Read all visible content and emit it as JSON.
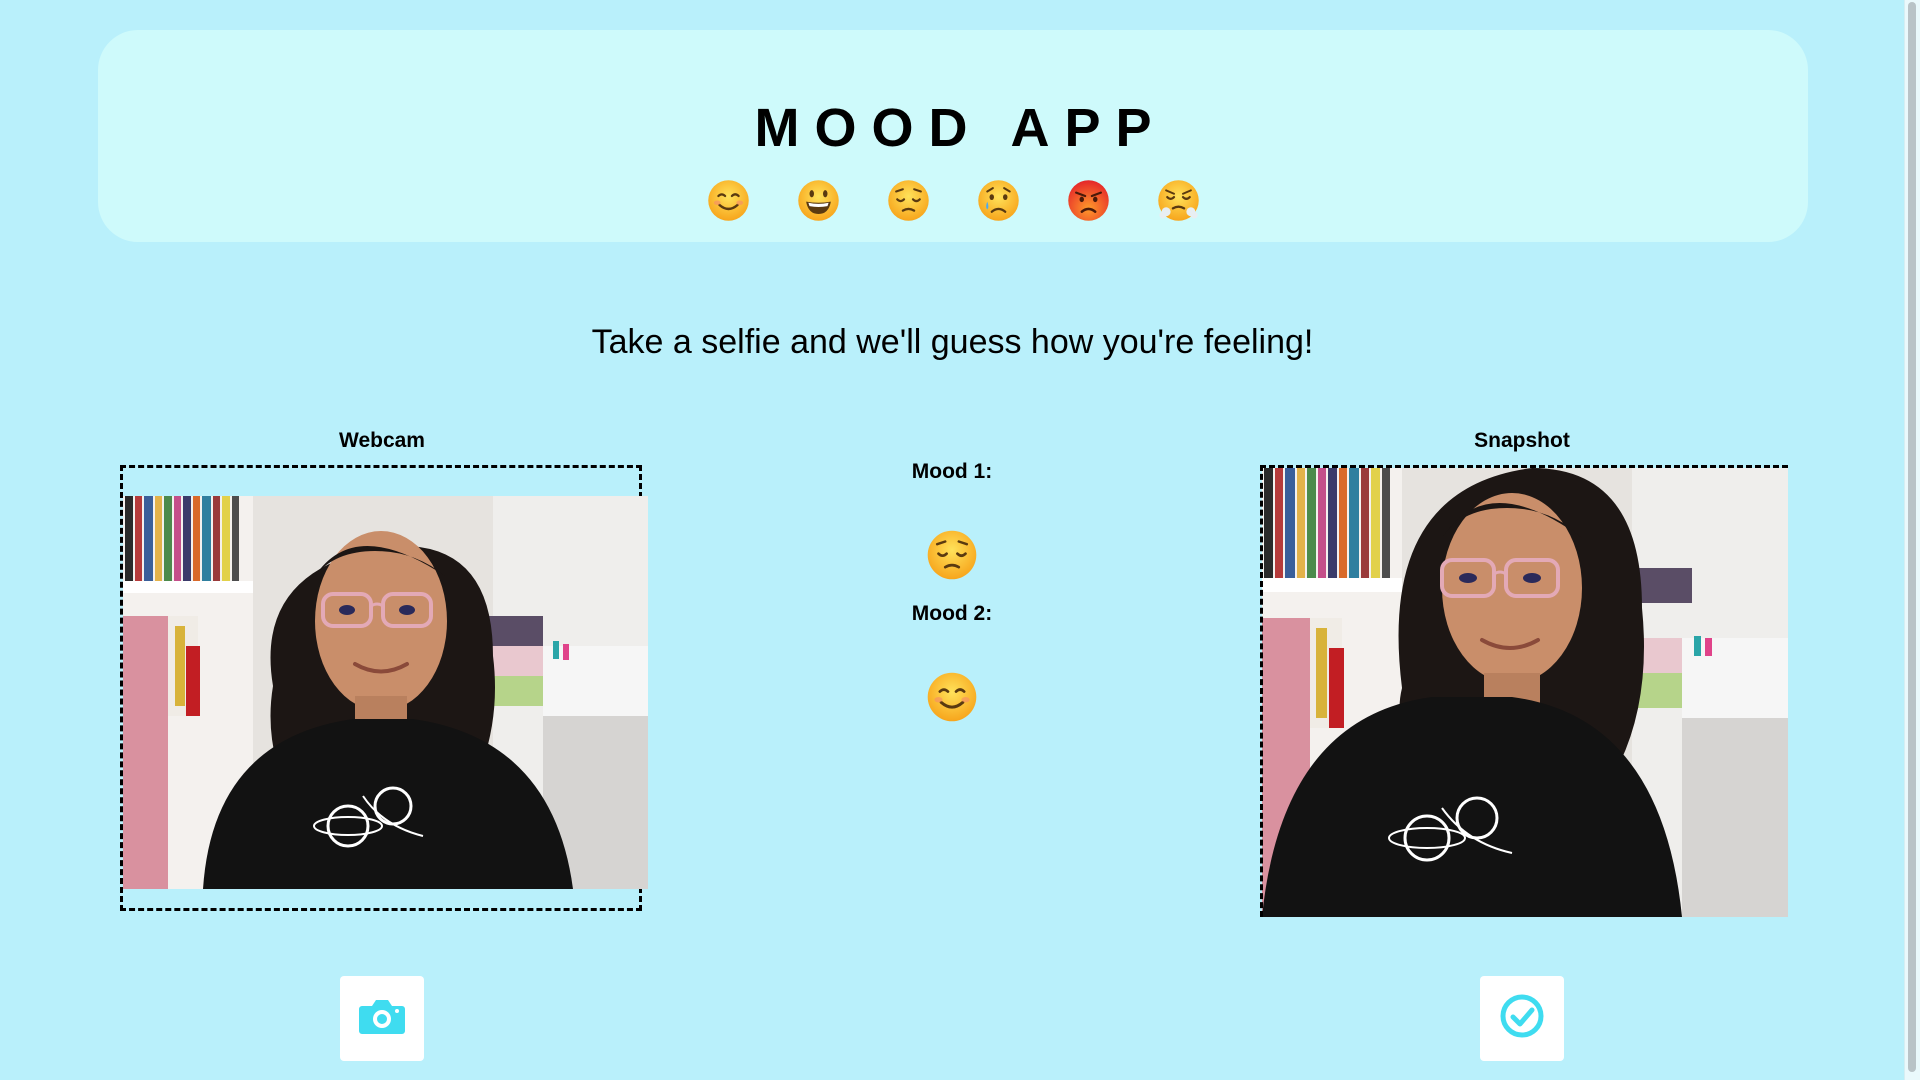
{
  "header": {
    "title": "MOOD APP",
    "emojis": [
      {
        "name": "smiling-face-icon",
        "glyph": "😊"
      },
      {
        "name": "grinning-face-icon",
        "glyph": "😀"
      },
      {
        "name": "pensive-face-icon",
        "glyph": "😔"
      },
      {
        "name": "crying-face-icon",
        "glyph": "😢"
      },
      {
        "name": "angry-face-icon",
        "glyph": "😡"
      },
      {
        "name": "steam-face-icon",
        "glyph": "😤"
      }
    ]
  },
  "subtitle": "Take a selfie and we'll guess how you're feeling!",
  "webcam": {
    "label": "Webcam"
  },
  "snapshot": {
    "label": "Snapshot"
  },
  "moods": {
    "mood1_label": "Mood 1:",
    "mood1_emoji": "pensive-face-icon",
    "mood2_label": "Mood 2:",
    "mood2_emoji": "smiling-face-icon"
  },
  "buttons": {
    "capture_icon": "camera-icon",
    "confirm_icon": "check-circle-icon"
  },
  "colors": {
    "background": "#b9f0fb",
    "header_bg": "#cefafb",
    "accent": "#3fdcf0"
  }
}
